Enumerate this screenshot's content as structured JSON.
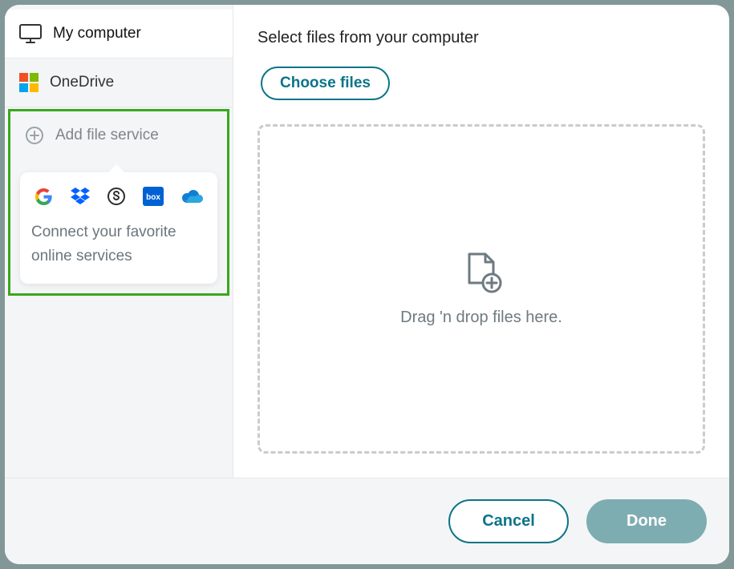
{
  "sidebar": {
    "my_computer": "My computer",
    "onedrive": "OneDrive",
    "add_service": "Add file service",
    "tooltip_text": "Connect your favorite online services",
    "service_icons": [
      "google",
      "dropbox",
      "S",
      "box",
      "onedrive"
    ]
  },
  "main": {
    "title": "Select files from your computer",
    "choose_files": "Choose files",
    "dropzone_text": "Drag 'n drop files here."
  },
  "footer": {
    "cancel": "Cancel",
    "done": "Done"
  }
}
